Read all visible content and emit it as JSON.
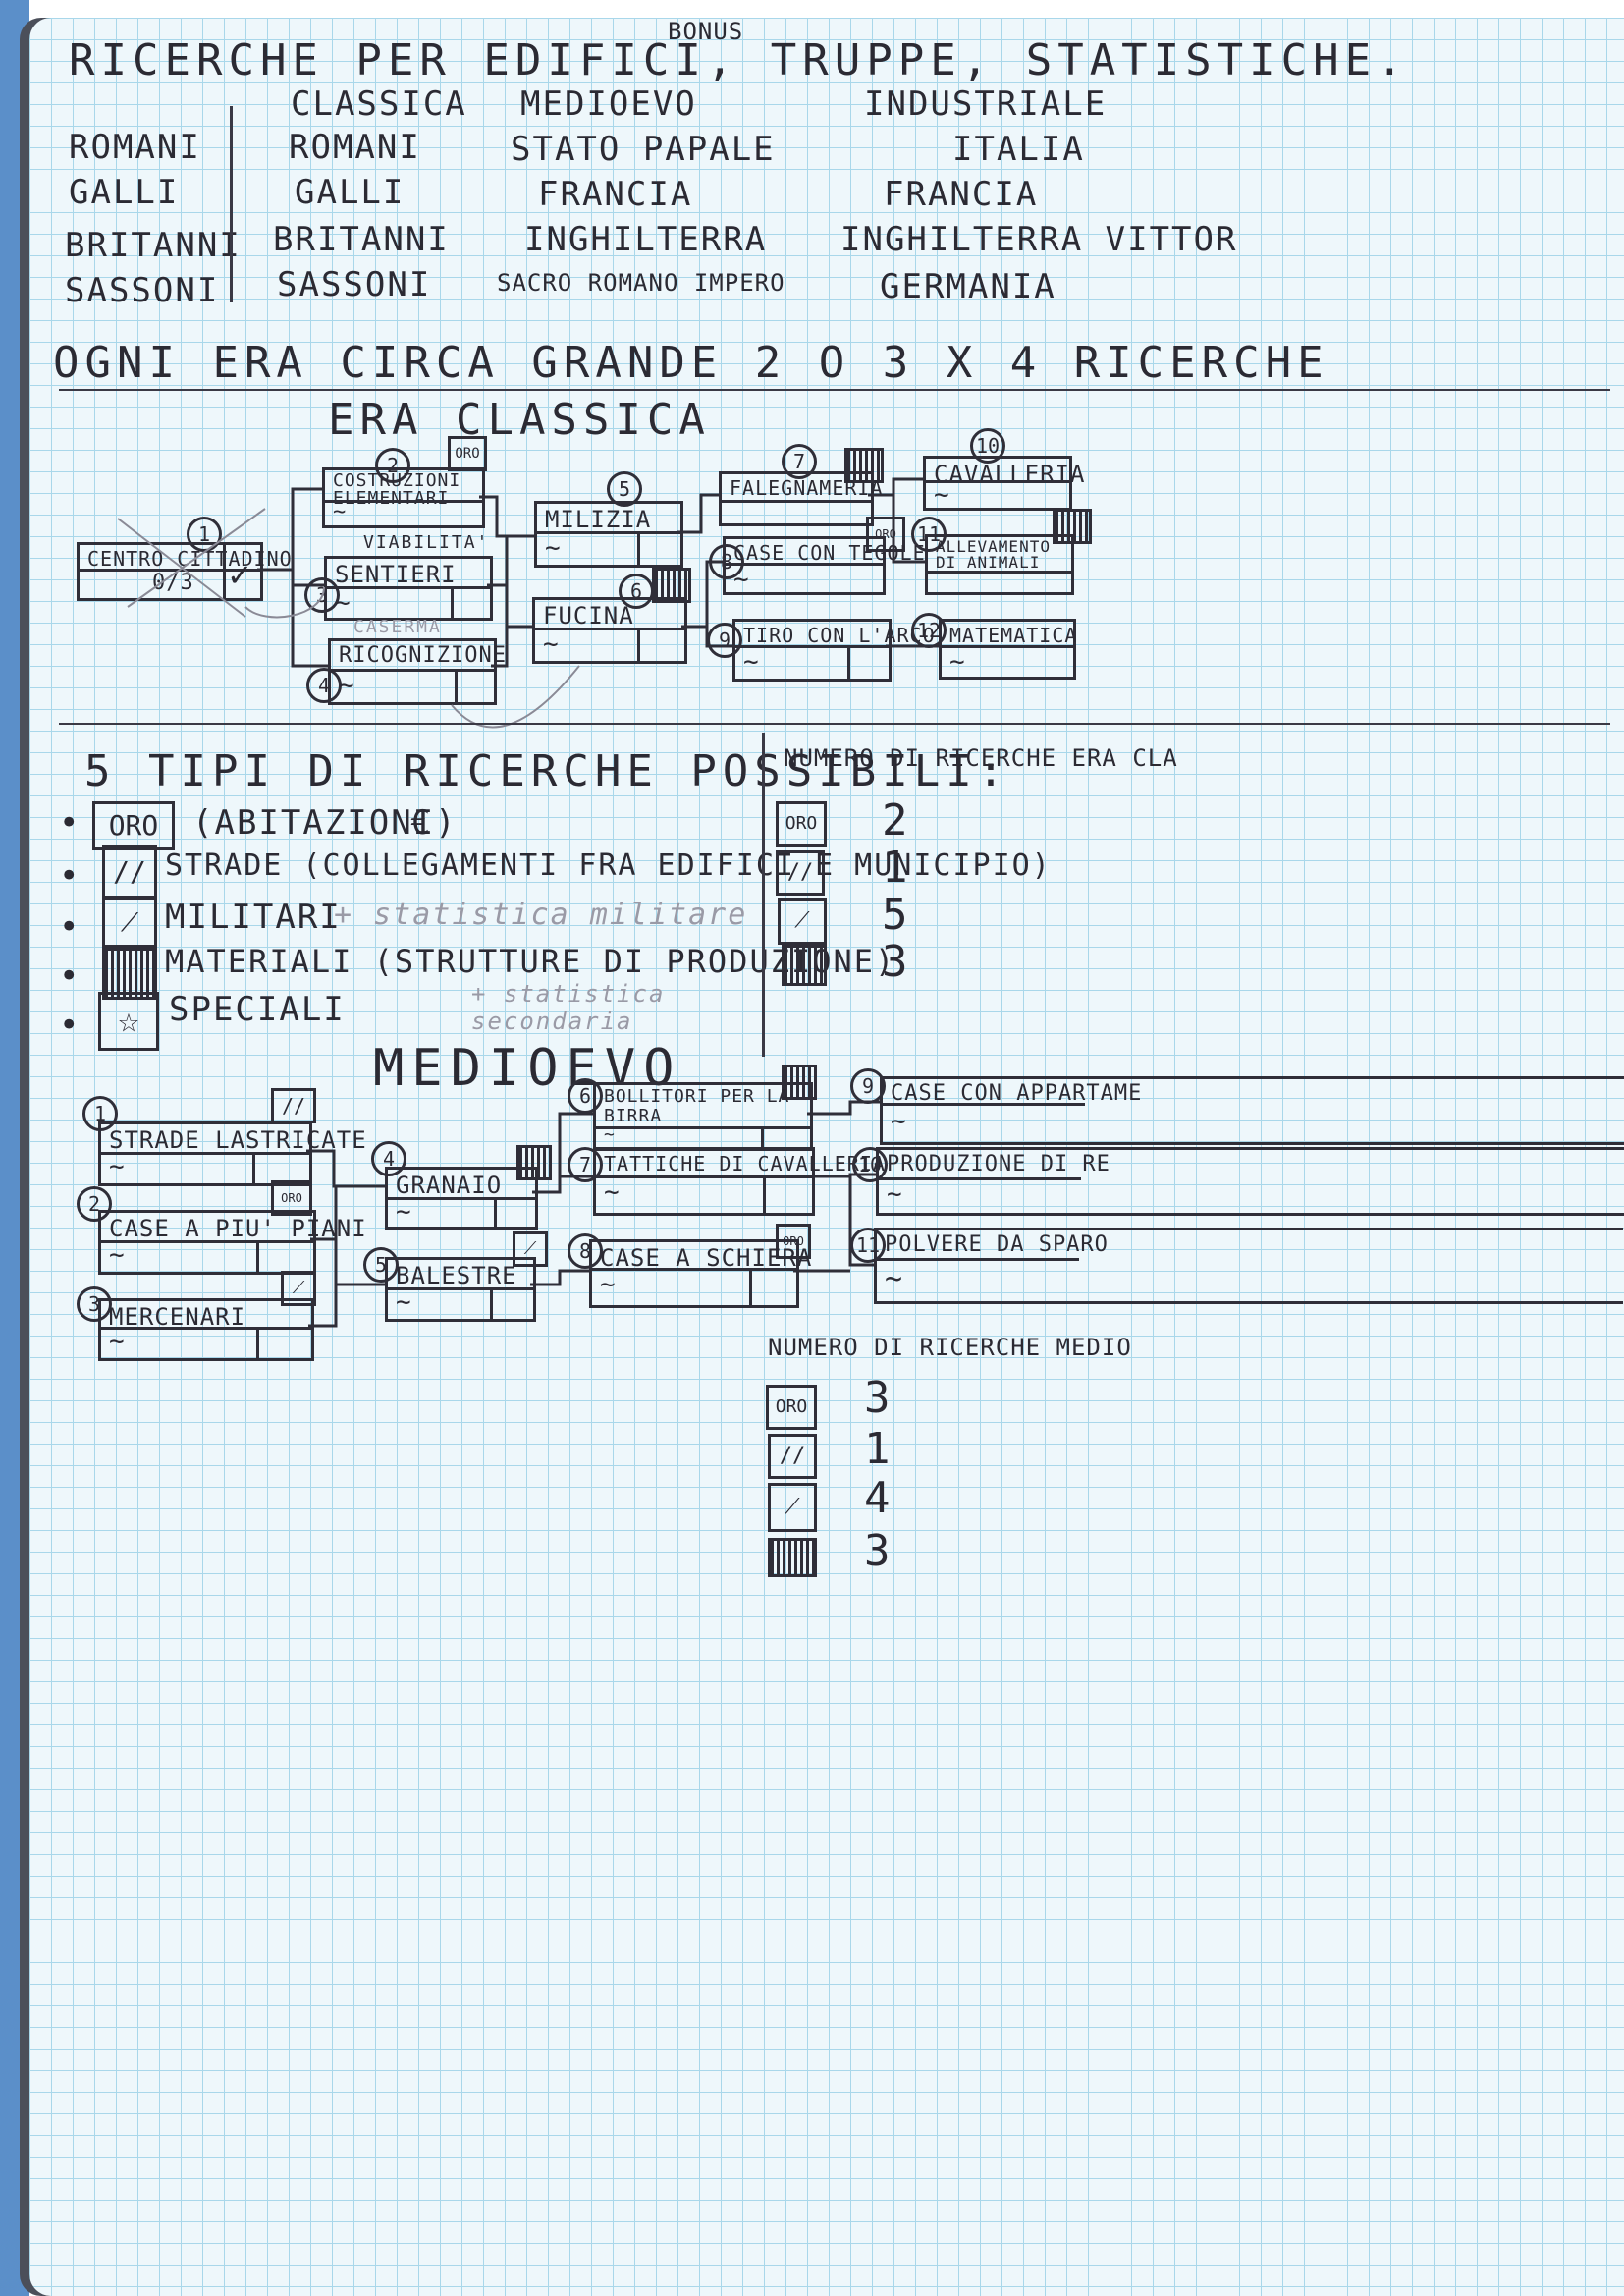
{
  "header": {
    "title": "RICERCHE PER EDIFICI, TRUPPE, STATISTICHE.",
    "bonus": "BONUS"
  },
  "civilizations": {
    "left": [
      "ROMANI",
      "GALLI",
      "BRITANNI",
      "SASSONI"
    ],
    "columns": [
      {
        "era": "CLASSICA",
        "items": [
          "ROMANI",
          "GALLI",
          "BRITANNI",
          "SASSONI"
        ]
      },
      {
        "era": "MEDIOEVO",
        "items": [
          "STATO PAPALE",
          "FRANCIA",
          "INGHILTERRA",
          "SACRO ROMANO IMPERO"
        ]
      },
      {
        "era": "INDUSTRIALE",
        "items": [
          "ITALIA",
          "FRANCIA",
          "INGHILTERRA VITTOR",
          "GERMANIA"
        ]
      }
    ]
  },
  "era_note": "OGNI ERA CIRCA GRANDE 2 O 3 X 4 RICERCHE",
  "classic": {
    "title": "ERA CLASSICA",
    "center": {
      "label": "CENTRO CITTADINO",
      "value": "0/3",
      "check": "✓"
    },
    "nodes": [
      {
        "num": "2",
        "label": "COSTRUZIONI ELEMENTARI",
        "badge": "ORO"
      },
      {
        "num": "3",
        "label": "SENTIERI",
        "note": "VIABILITA'"
      },
      {
        "num": "4",
        "label": "RICOGNIZIONE",
        "note": "CASERMA"
      },
      {
        "num": "5",
        "label": "MILIZIA"
      },
      {
        "num": "6",
        "label": "FUCINA"
      },
      {
        "num": "7",
        "label": "FALEGNAMERIA"
      },
      {
        "num": "8",
        "label": "CASE CON TEGOLE",
        "badge": "ORO"
      },
      {
        "num": "9",
        "label": "TIRO CON L'ARCO"
      },
      {
        "num": "10",
        "label": "CAVALLERIA"
      },
      {
        "num": "11",
        "label": "ALLEVAMENTO DI ANIMALI"
      },
      {
        "num": "12",
        "label": "MATEMATICA"
      }
    ]
  },
  "types": {
    "title": "5 TIPI DI RICERCHE POSSIBILI:",
    "items": [
      {
        "icon": "ORO",
        "text": "(ABITAZIONI)",
        "extra": "€"
      },
      {
        "icon": "//",
        "text": "STRADE (COLLEGAMENTI FRA EDIFICI E MUNICIPIO)"
      },
      {
        "icon": "sword",
        "text": "MILITARI",
        "extra": "+ statistica militare"
      },
      {
        "icon": "hatch",
        "text": "MATERIALI (STRUTTURE DI PRODUZIONE)"
      },
      {
        "icon": "star",
        "text": "SPECIALI",
        "extra": "+ statistica secondaria"
      }
    ]
  },
  "count_classic": {
    "title": "NUMERO DI RICERCHE ERA CLA",
    "rows": [
      {
        "icon": "ORO",
        "n": "2"
      },
      {
        "icon": "//",
        "n": "1"
      },
      {
        "icon": "sword",
        "n": "5"
      },
      {
        "icon": "hatch",
        "n": "3"
      }
    ]
  },
  "medieval": {
    "title": "MEDIOEVO",
    "nodes": [
      {
        "num": "1",
        "label": "STRADE LASTRICATE"
      },
      {
        "num": "2",
        "label": "CASE A PIU' PIANI",
        "badge": "ORO"
      },
      {
        "num": "3",
        "label": "MERCENARI"
      },
      {
        "num": "4",
        "label": "GRANAIO"
      },
      {
        "num": "5",
        "label": "BALESTRE"
      },
      {
        "num": "6",
        "label": "BOLLITORI PER LA BIRRA"
      },
      {
        "num": "7",
        "label": "TATTICHE DI CAVALLERIA"
      },
      {
        "num": "8",
        "label": "CASE A SCHIERA",
        "badge": "ORO"
      },
      {
        "num": "9",
        "label": "CASE CON APPARTAME"
      },
      {
        "num": "10",
        "label": "PRODUZIONE DI RE"
      },
      {
        "num": "11",
        "label": "POLVERE DA SPARO"
      }
    ]
  },
  "count_medieval": {
    "title": "NUMERO DI RICERCHE MEDIO",
    "rows": [
      {
        "icon": "ORO",
        "n": "3"
      },
      {
        "icon": "//",
        "n": "1"
      },
      {
        "icon": "sword",
        "n": "4"
      },
      {
        "icon": "hatch",
        "n": "3"
      }
    ]
  }
}
